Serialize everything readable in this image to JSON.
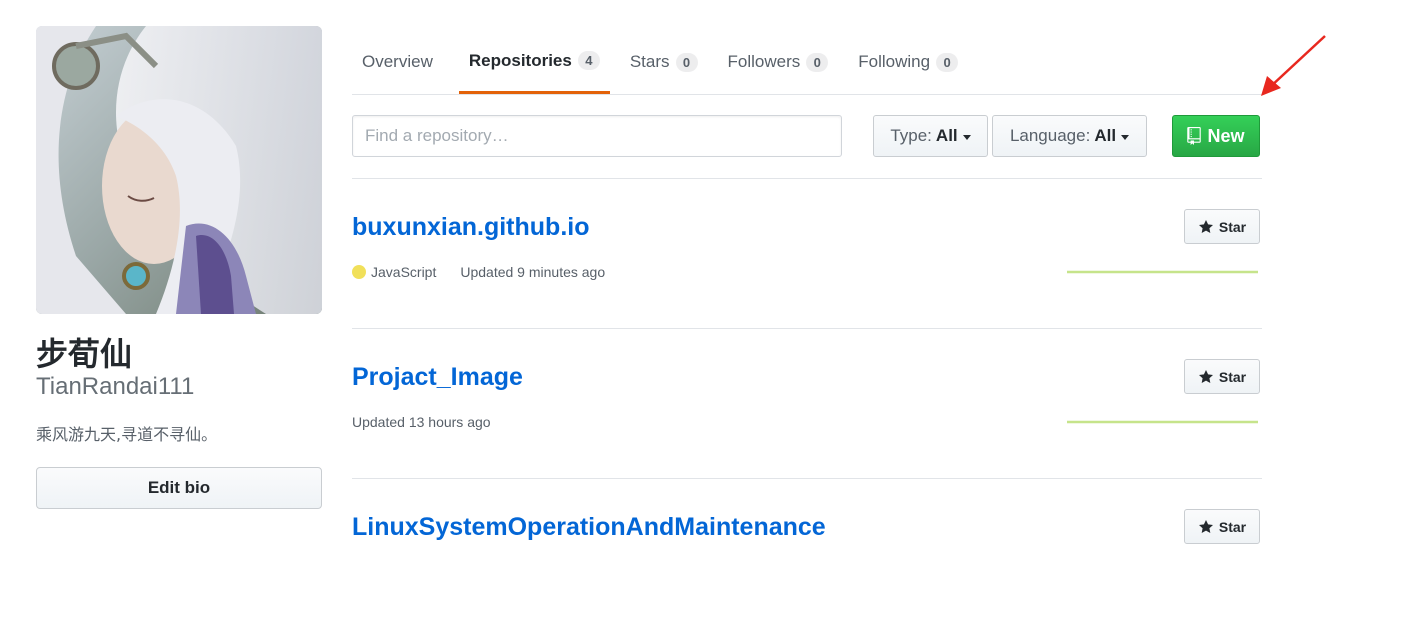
{
  "profile": {
    "display_name": "步荀仙",
    "username": "TianRandai111",
    "bio": "乘风游九天,寻道不寻仙。",
    "edit_bio_label": "Edit bio"
  },
  "tabs": [
    {
      "label": "Overview",
      "count": null,
      "selected": false
    },
    {
      "label": "Repositories",
      "count": "4",
      "selected": true
    },
    {
      "label": "Stars",
      "count": "0",
      "selected": false
    },
    {
      "label": "Followers",
      "count": "0",
      "selected": false
    },
    {
      "label": "Following",
      "count": "0",
      "selected": false
    }
  ],
  "filters": {
    "search_placeholder": "Find a repository…",
    "type_label": "Type:",
    "type_value": "All",
    "language_label": "Language:",
    "language_value": "All",
    "new_label": "New"
  },
  "repos": [
    {
      "name": "buxunxian.github.io",
      "language": "JavaScript",
      "language_color": "#f1e05a",
      "updated": "Updated 9 minutes ago",
      "star_label": "Star"
    },
    {
      "name": "Projact_Image",
      "language": null,
      "updated": "Updated 13 hours ago",
      "star_label": "Star"
    },
    {
      "name": "LinuxSystemOperationAndMaintenance",
      "language": null,
      "updated": "",
      "star_label": "Star"
    }
  ],
  "colors": {
    "accent_tab": "#e36209",
    "link": "#0366d6",
    "new_button": "#28a745",
    "annotation_arrow": "#e8281f"
  },
  "icons": {
    "new_button": "repo-icon",
    "star_button": "star-icon",
    "filter_dropdown": "caret-down-icon"
  }
}
